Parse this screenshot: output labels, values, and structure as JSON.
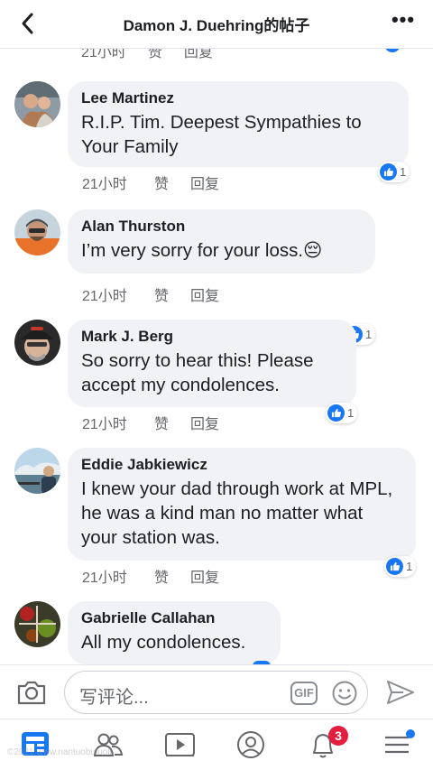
{
  "header": {
    "title": "Damon J. Duehring的帖子"
  },
  "previous_comment": {
    "time": "21小时",
    "like": "赞",
    "reply": "回复"
  },
  "comments": [
    {
      "name": "Lee Martinez",
      "text": "R.I.P. Tim. Deepest Sympathies to Your Family",
      "time": "21小时",
      "like": "赞",
      "reply": "回复",
      "reactions": "1"
    },
    {
      "name": "Alan Thurston",
      "text": "I’m very sorry for your loss.😔",
      "time": "21小时",
      "like": "赞",
      "reply": "回复",
      "reactions": "1"
    },
    {
      "name": "Mark J. Berg",
      "text": "So sorry to hear this! Please accept my condolences.",
      "time": "21小时",
      "like": "赞",
      "reply": "回复",
      "reactions": "1"
    },
    {
      "name": "Eddie Jabkiewicz",
      "text": "I knew your dad through work at MPL, he was a kind man no matter what your station was.",
      "time": "21小时",
      "like": "赞",
      "reply": "回复",
      "reactions": "1"
    },
    {
      "name": "Gabrielle Callahan",
      "text": "All my condolences."
    }
  ],
  "composer": {
    "placeholder": "写评论...",
    "gif_label": "GIF"
  },
  "tabbar": {
    "notification_badge": "3"
  },
  "watermark": "©2021 www.nantuobuluoli..."
}
